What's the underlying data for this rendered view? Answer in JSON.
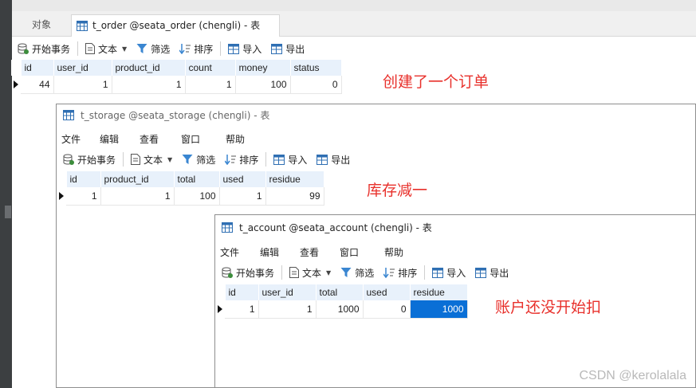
{
  "colors": {
    "annotation": "#e8302b",
    "selection": "#0a6fd6",
    "header_bg": "#e8f1fb"
  },
  "main": {
    "tabs": [
      {
        "label": "对象"
      },
      {
        "label": "t_order @seata_order (chengli) - 表"
      }
    ],
    "toolbar": {
      "begin_tx": "开始事务",
      "text": "文本",
      "filter": "筛选",
      "sort": "排序",
      "import": "导入",
      "export": "导出"
    },
    "table": {
      "columns": [
        "id",
        "user_id",
        "product_id",
        "count",
        "money",
        "status"
      ],
      "rows": [
        [
          "44",
          "1",
          "1",
          "1",
          "100",
          "0"
        ]
      ]
    },
    "annotation": "创建了一个订单"
  },
  "storage_window": {
    "title": "t_storage @seata_storage (chengli) - 表",
    "menu": [
      "文件",
      "编辑",
      "查看",
      "窗口",
      "帮助"
    ],
    "toolbar": {
      "begin_tx": "开始事务",
      "text": "文本",
      "filter": "筛选",
      "sort": "排序",
      "import": "导入",
      "export": "导出"
    },
    "table": {
      "columns": [
        "id",
        "product_id",
        "total",
        "used",
        "residue"
      ],
      "rows": [
        [
          "1",
          "1",
          "100",
          "1",
          "99"
        ]
      ]
    },
    "annotation": "库存减一"
  },
  "account_window": {
    "title": "t_account @seata_account (chengli) - 表",
    "menu": [
      "文件",
      "编辑",
      "查看",
      "窗口",
      "帮助"
    ],
    "toolbar": {
      "begin_tx": "开始事务",
      "text": "文本",
      "filter": "筛选",
      "sort": "排序",
      "import": "导入",
      "export": "导出"
    },
    "table": {
      "columns": [
        "id",
        "user_id",
        "total",
        "used",
        "residue"
      ],
      "rows": [
        [
          "1",
          "1",
          "1000",
          "0",
          "1000"
        ]
      ]
    },
    "annotation": "账户还没开始扣"
  },
  "watermark": "CSDN @kerolalala"
}
